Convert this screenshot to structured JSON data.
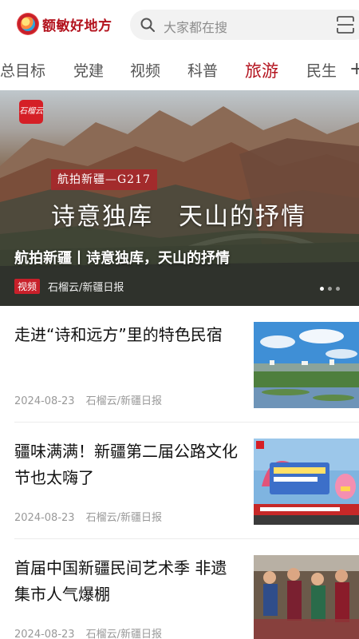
{
  "header": {
    "logo_text": "额敏好地方",
    "search_placeholder": "大家都在搜"
  },
  "tabs": [
    {
      "label": "总目标",
      "active": false
    },
    {
      "label": "党建",
      "active": false
    },
    {
      "label": "视频",
      "active": false
    },
    {
      "label": "科普",
      "active": false
    },
    {
      "label": "旅游",
      "active": true
    },
    {
      "label": "民生",
      "active": false
    }
  ],
  "tab_more": "+",
  "hero": {
    "badge": "石榴云",
    "tag": "航拍新疆—G217",
    "poem": "诗意独库　天山的抒情",
    "title": "航拍新疆丨诗意独库，天山的抒情",
    "type_label": "视频",
    "source": "石榴云/新疆日报",
    "slide_count": 3,
    "active_slide": 1
  },
  "news": [
    {
      "title": "走进“诗和远方”里的特色民宿",
      "date": "2024-08-23",
      "source": "石榴云/新疆日报",
      "thumb": "lakeside-village"
    },
    {
      "title": "疆味满满！新疆第二届公路文化节也太嗨了",
      "date": "2024-08-23",
      "source": "石榴云/新疆日报",
      "thumb": "festival-stage"
    },
    {
      "title": "首届中国新疆民间艺术季 非遗集市人气爆棚",
      "date": "2024-08-23",
      "source": "石榴云/新疆日报",
      "thumb": "folk-dancers"
    }
  ],
  "colors": {
    "brand": "#b3121d",
    "muted": "#999999"
  }
}
